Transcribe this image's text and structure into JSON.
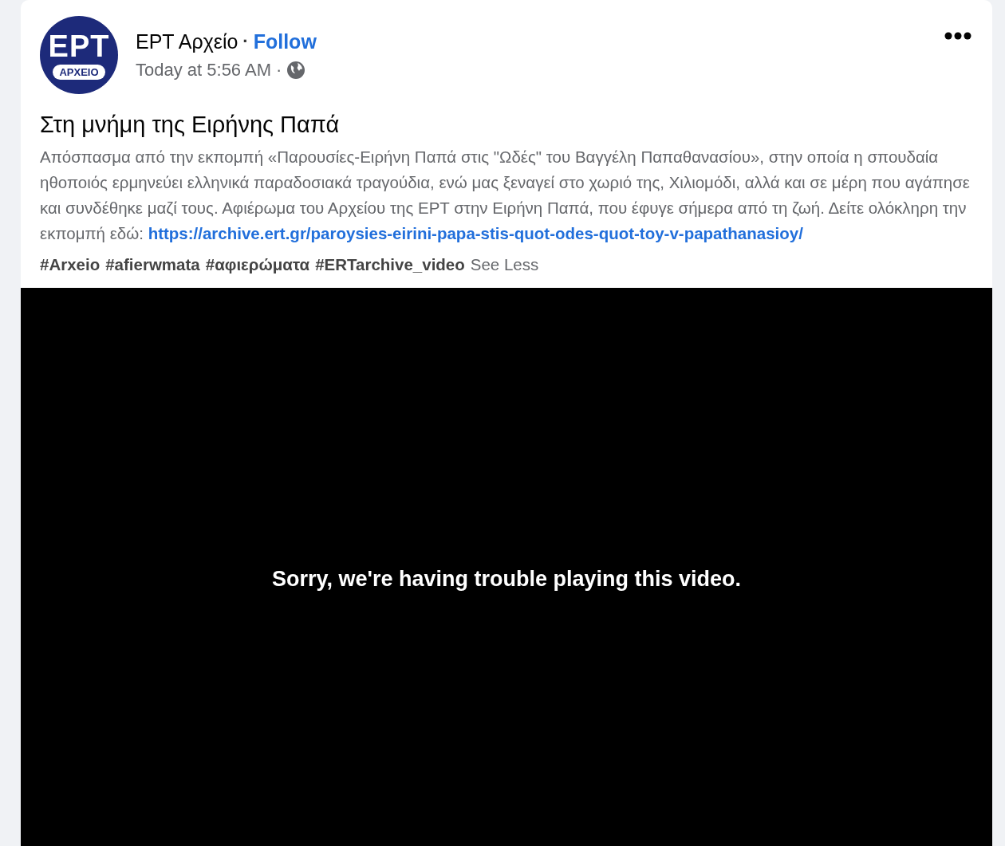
{
  "post": {
    "author": "ΕΡΤ Αρχείο",
    "separator": "·",
    "follow": "Follow",
    "timestamp": "Today at 5:56 AM",
    "timestamp_separator": "·",
    "logo": {
      "top": "ΕΡΤ",
      "badge": "ΑΡΧΕΙΟ"
    },
    "title": "Στη μνήμη της Ειρήνης Παπά",
    "description": "Απόσπασμα από την εκπομπή «Παρουσίες-Ειρήνη Παπά στις \"Ωδές\" του Βαγγέλη Παπαθανασίου», στην οποία η σπουδαία ηθοποιός ερμηνεύει ελληνικά παραδοσιακά τραγούδια, ενώ μας ξεναγεί στο χωριό της, Χιλιομόδι, αλλά και σε μέρη που αγάπησε και συνδέθηκε μαζί τους. Αφιέρωμα του Αρχείου της ΕΡΤ στην Ειρήνη Παπά, που έφυγε σήμερα από τη ζωή. Δείτε ολόκληρη την εκπομπή εδώ:",
    "link": "https://archive.ert.gr/paroysies-eirini-papa-stis-quot-odes-quot-toy-v-papathanasioy/",
    "hashtags": [
      "#Arxeio",
      "#afierwmata",
      "#αφιερώματα",
      "#ERTarchive_video"
    ],
    "see_less": "See Less",
    "video": {
      "error": "Sorry, we're having trouble playing this video."
    }
  }
}
